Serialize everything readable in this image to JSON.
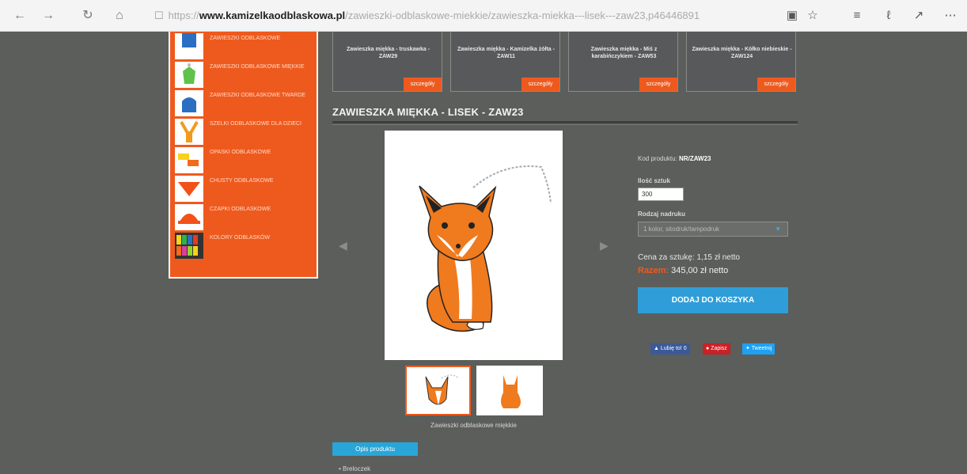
{
  "browser": {
    "url_prefix": "https://",
    "url_host": "www.kamizelkaodblaskowa.pl",
    "url_path": "/zawieszki-odblaskowe-miekkie/zawieszka-miekka---lisek---zaw23,p46446891"
  },
  "sidebar": {
    "items": [
      {
        "label": "ZAWIESZKI ODBLASKOWE"
      },
      {
        "label": "ZAWIESZKI ODBLASKOWE MIĘKKIE"
      },
      {
        "label": "ZAWIESZKI ODBLASKOWE TWARDE"
      },
      {
        "label": "SZELKI ODBLASKOWE DLA DZIECI"
      },
      {
        "label": "OPASKI ODBLASKOWE"
      },
      {
        "label": "CHUSTY ODBLASKOWE"
      },
      {
        "label": "CZAPKI ODBLASKOWE"
      },
      {
        "label": "KOLORY ODBLASKÓW"
      }
    ]
  },
  "strip": {
    "items": [
      {
        "title": "Zawieszka miękka - truskawka - ZAW29",
        "button": "szczegóły"
      },
      {
        "title": "Zawieszka miękka - Kamizelka żółta - ZAW11",
        "button": "szczegóły"
      },
      {
        "title": "Zawieszka miękka - Miś z karabińczykiem - ZAW53",
        "button": "szczegóły"
      },
      {
        "title": "Zawieszka miękka - Kółko niebieskie - ZAW124",
        "button": "szczegóły"
      }
    ]
  },
  "product": {
    "title": "ZAWIESZKA MIĘKKA - LISEK - ZAW23",
    "code_label": "Kod produktu:",
    "code_value": "NR/ZAW23",
    "qty_label": "Ilość sztuk",
    "qty_value": "300",
    "print_label": "Rodzaj nadruku",
    "print_value": "1 kolor, sitodruk/tampodruk",
    "unit_price": "Cena za sztukę: 1,15 zł netto",
    "total_label": "Razem:",
    "total_value": "345,00 zł netto",
    "add_to_cart": "DODAJ DO KOSZYKA",
    "caption": "Zawieszki odblaskowe miękkie",
    "like": "Lubię to! 0",
    "pin": "Zapisz",
    "tweet": "Tweetnij",
    "tab": "Opis produktu",
    "bullet": "Breloczek"
  },
  "colors": {
    "accent": "#ee5a1e",
    "button": "#2f9ed8",
    "facebook": "#3b5998",
    "pinterest": "#cb2027",
    "twitter": "#1da1f2"
  }
}
